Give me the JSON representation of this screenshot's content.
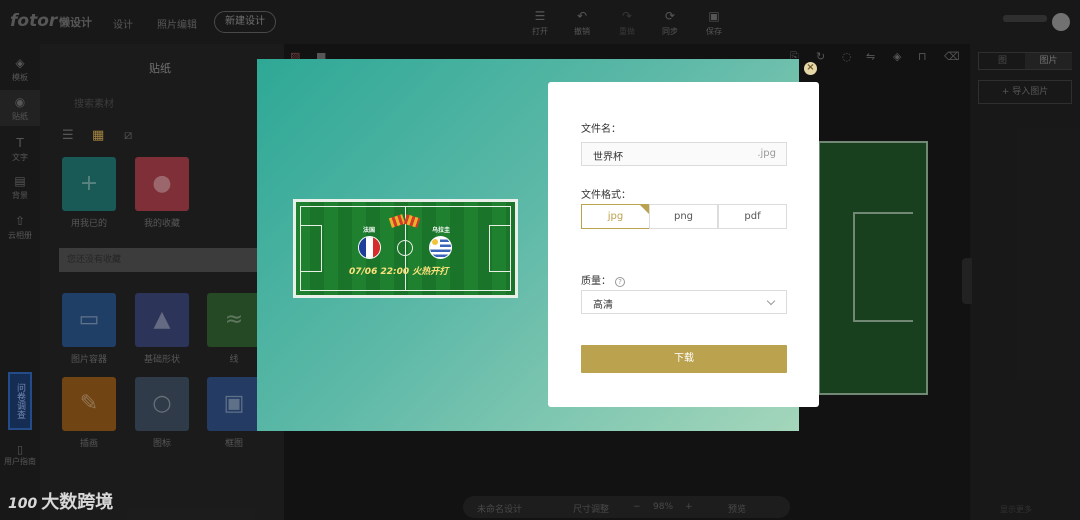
{
  "header": {
    "logo": "fotor",
    "logo_sub": "懒设计",
    "nav": [
      "设计",
      "照片编辑"
    ],
    "new_design": "新建设计",
    "tools": [
      {
        "icon": "menu-icon",
        "label": "打开"
      },
      {
        "icon": "undo-icon",
        "label": "撤销"
      },
      {
        "icon": "redo-icon",
        "label": "重做"
      },
      {
        "icon": "sync-icon",
        "label": "同步"
      },
      {
        "icon": "save-icon",
        "label": "保存"
      }
    ]
  },
  "rail": [
    {
      "icon": "template-icon",
      "label": "模板"
    },
    {
      "icon": "sticker-icon",
      "label": "贴纸"
    },
    {
      "icon": "text-icon",
      "label": "文字"
    },
    {
      "icon": "background-icon",
      "label": "背景"
    },
    {
      "icon": "cloud-icon",
      "label": "云相册"
    }
  ],
  "rail_feedback": "问卷调查",
  "rail_guide": "用户指南",
  "panel": {
    "title": "贴纸",
    "search_placeholder": "搜索素材",
    "tiles_top": [
      {
        "label": "用我已的",
        "color": "#1f6e6a",
        "glyph": "+"
      },
      {
        "label": "我的收藏",
        "color": "#9a3a44",
        "glyph": "👤"
      }
    ],
    "collect_hint": "您还没有收藏",
    "tiles_grid": [
      {
        "label": "图片容器",
        "color": "#284e7d",
        "glyph": "🖼"
      },
      {
        "label": "基础形状",
        "color": "#36406e",
        "glyph": "▲"
      },
      {
        "label": "线",
        "color": "#2c5a2c",
        "glyph": "≈"
      },
      {
        "label": "插画",
        "color": "#8a5418",
        "glyph": "✎"
      },
      {
        "label": "图标",
        "color": "#3a4858",
        "glyph": "💡"
      },
      {
        "label": "框图",
        "color": "#2c4a7a",
        "glyph": "🖼"
      }
    ]
  },
  "canvas": {
    "zoombar": {
      "left": "未命名设计",
      "resize": "尺寸调整",
      "minus": "−",
      "zoom": "98%",
      "plus": "+",
      "preview": "预览"
    }
  },
  "right_panel": {
    "tabs": [
      "图",
      "图片"
    ],
    "import_button": "+ 导入图片",
    "bottom": "显示更多"
  },
  "modal": {
    "preview": {
      "team_left": "法国",
      "team_right": "乌拉圭",
      "match_text": "07/06 22:00 火热开打"
    },
    "dialog": {
      "filename_label": "文件名：",
      "filename_value": "世界杯",
      "filename_ext": ".jpg",
      "format_label": "文件格式：",
      "formats": [
        "jpg",
        "png",
        "pdf"
      ],
      "selected_format": "jpg",
      "quality_label": "质量：",
      "quality_value": "高清",
      "download": "下载"
    },
    "close": "×"
  },
  "watermark": {
    "logo": "100",
    "text": "大数跨境"
  }
}
